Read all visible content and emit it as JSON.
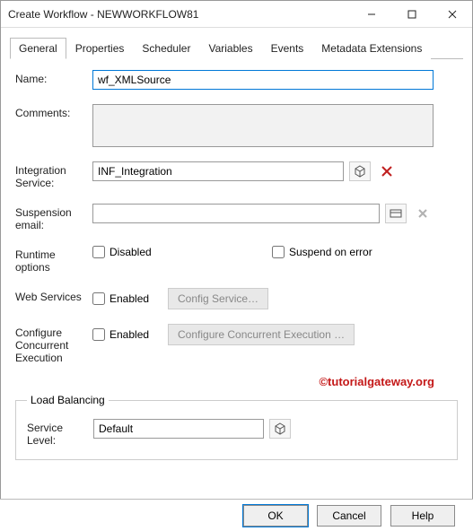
{
  "window": {
    "title": "Create Workflow - NEWWORKFLOW81"
  },
  "tabs": {
    "items": [
      "General",
      "Properties",
      "Scheduler",
      "Variables",
      "Events",
      "Metadata Extensions"
    ],
    "active": 0
  },
  "labels": {
    "name": "Name:",
    "comments": "Comments:",
    "integration_service": "Integration Service:",
    "suspension_email": "Suspension email:",
    "runtime_options": "Runtime options",
    "web_services": "Web Services",
    "configure_exec": "Configure Concurrent Execution",
    "load_balancing": "Load Balancing",
    "service_level": "Service Level:"
  },
  "fields": {
    "name": "wf_XMLSource",
    "comments": "",
    "integration_service": "INF_Integration",
    "suspension_email": "",
    "service_level": "Default"
  },
  "checkboxes": {
    "disabled": "Disabled",
    "suspend_on_error": "Suspend on error",
    "ws_enabled": "Enabled",
    "cc_enabled": "Enabled"
  },
  "buttons": {
    "config_service": "Config Service…",
    "configure_concurrent": "Configure Concurrent Execution …",
    "ok": "OK",
    "cancel": "Cancel",
    "help": "Help"
  },
  "icons": {
    "browse": "cube",
    "delete": "x",
    "sus_browse": "card",
    "sus_clear": "x"
  },
  "watermark": "©tutorialgateway.org"
}
